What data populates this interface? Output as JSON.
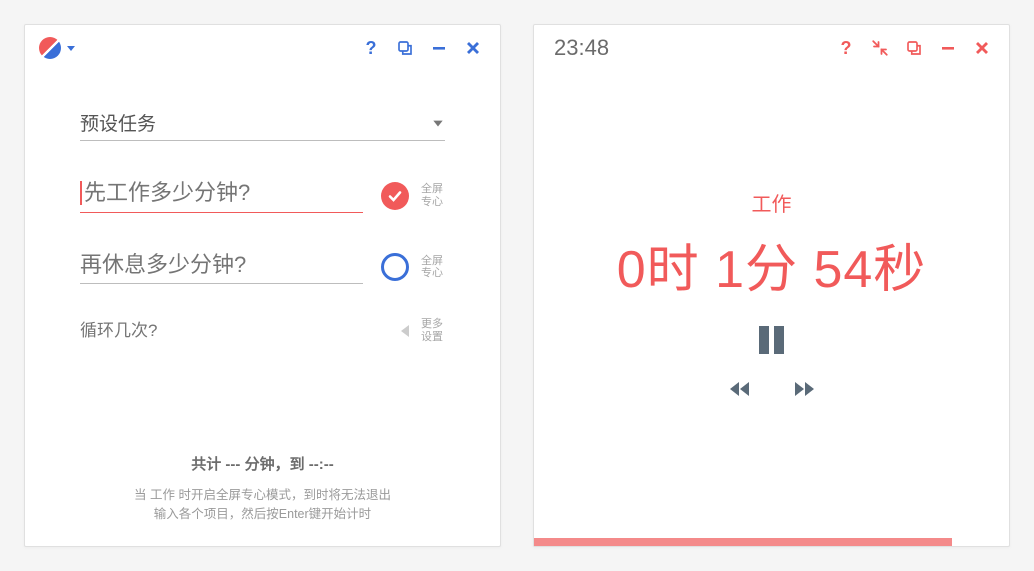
{
  "colors": {
    "accent_red": "#f15a5a",
    "accent_blue": "#3a6fd8",
    "grey": "#9a9a9a"
  },
  "left": {
    "titlebar": {
      "help_tooltip": "帮助",
      "topmost_tooltip": "置顶",
      "minimize_tooltip": "最小化",
      "close_tooltip": "关闭"
    },
    "form": {
      "preset_task_label": "预设任务",
      "work_placeholder": "先工作多少分钟?",
      "work_fullscreen_label": "全屏\n专心",
      "work_fullscreen_checked": true,
      "rest_placeholder": "再休息多少分钟?",
      "rest_fullscreen_label": "全屏\n专心",
      "rest_fullscreen_checked": false,
      "loop_placeholder": "循环几次?",
      "more_settings_label": "更多\n设置"
    },
    "footer": {
      "total_line": "共计 --- 分钟，到 --:--",
      "hint1": "当 工作 时开启全屏专心模式，到时将无法退出",
      "hint2": "输入各个项目，然后按Enter键开始计时"
    }
  },
  "right": {
    "titlebar": {
      "time": "23:48"
    },
    "mode_label": "工作",
    "timer_display": "0时 1分 54秒",
    "progress_percent": 88
  }
}
